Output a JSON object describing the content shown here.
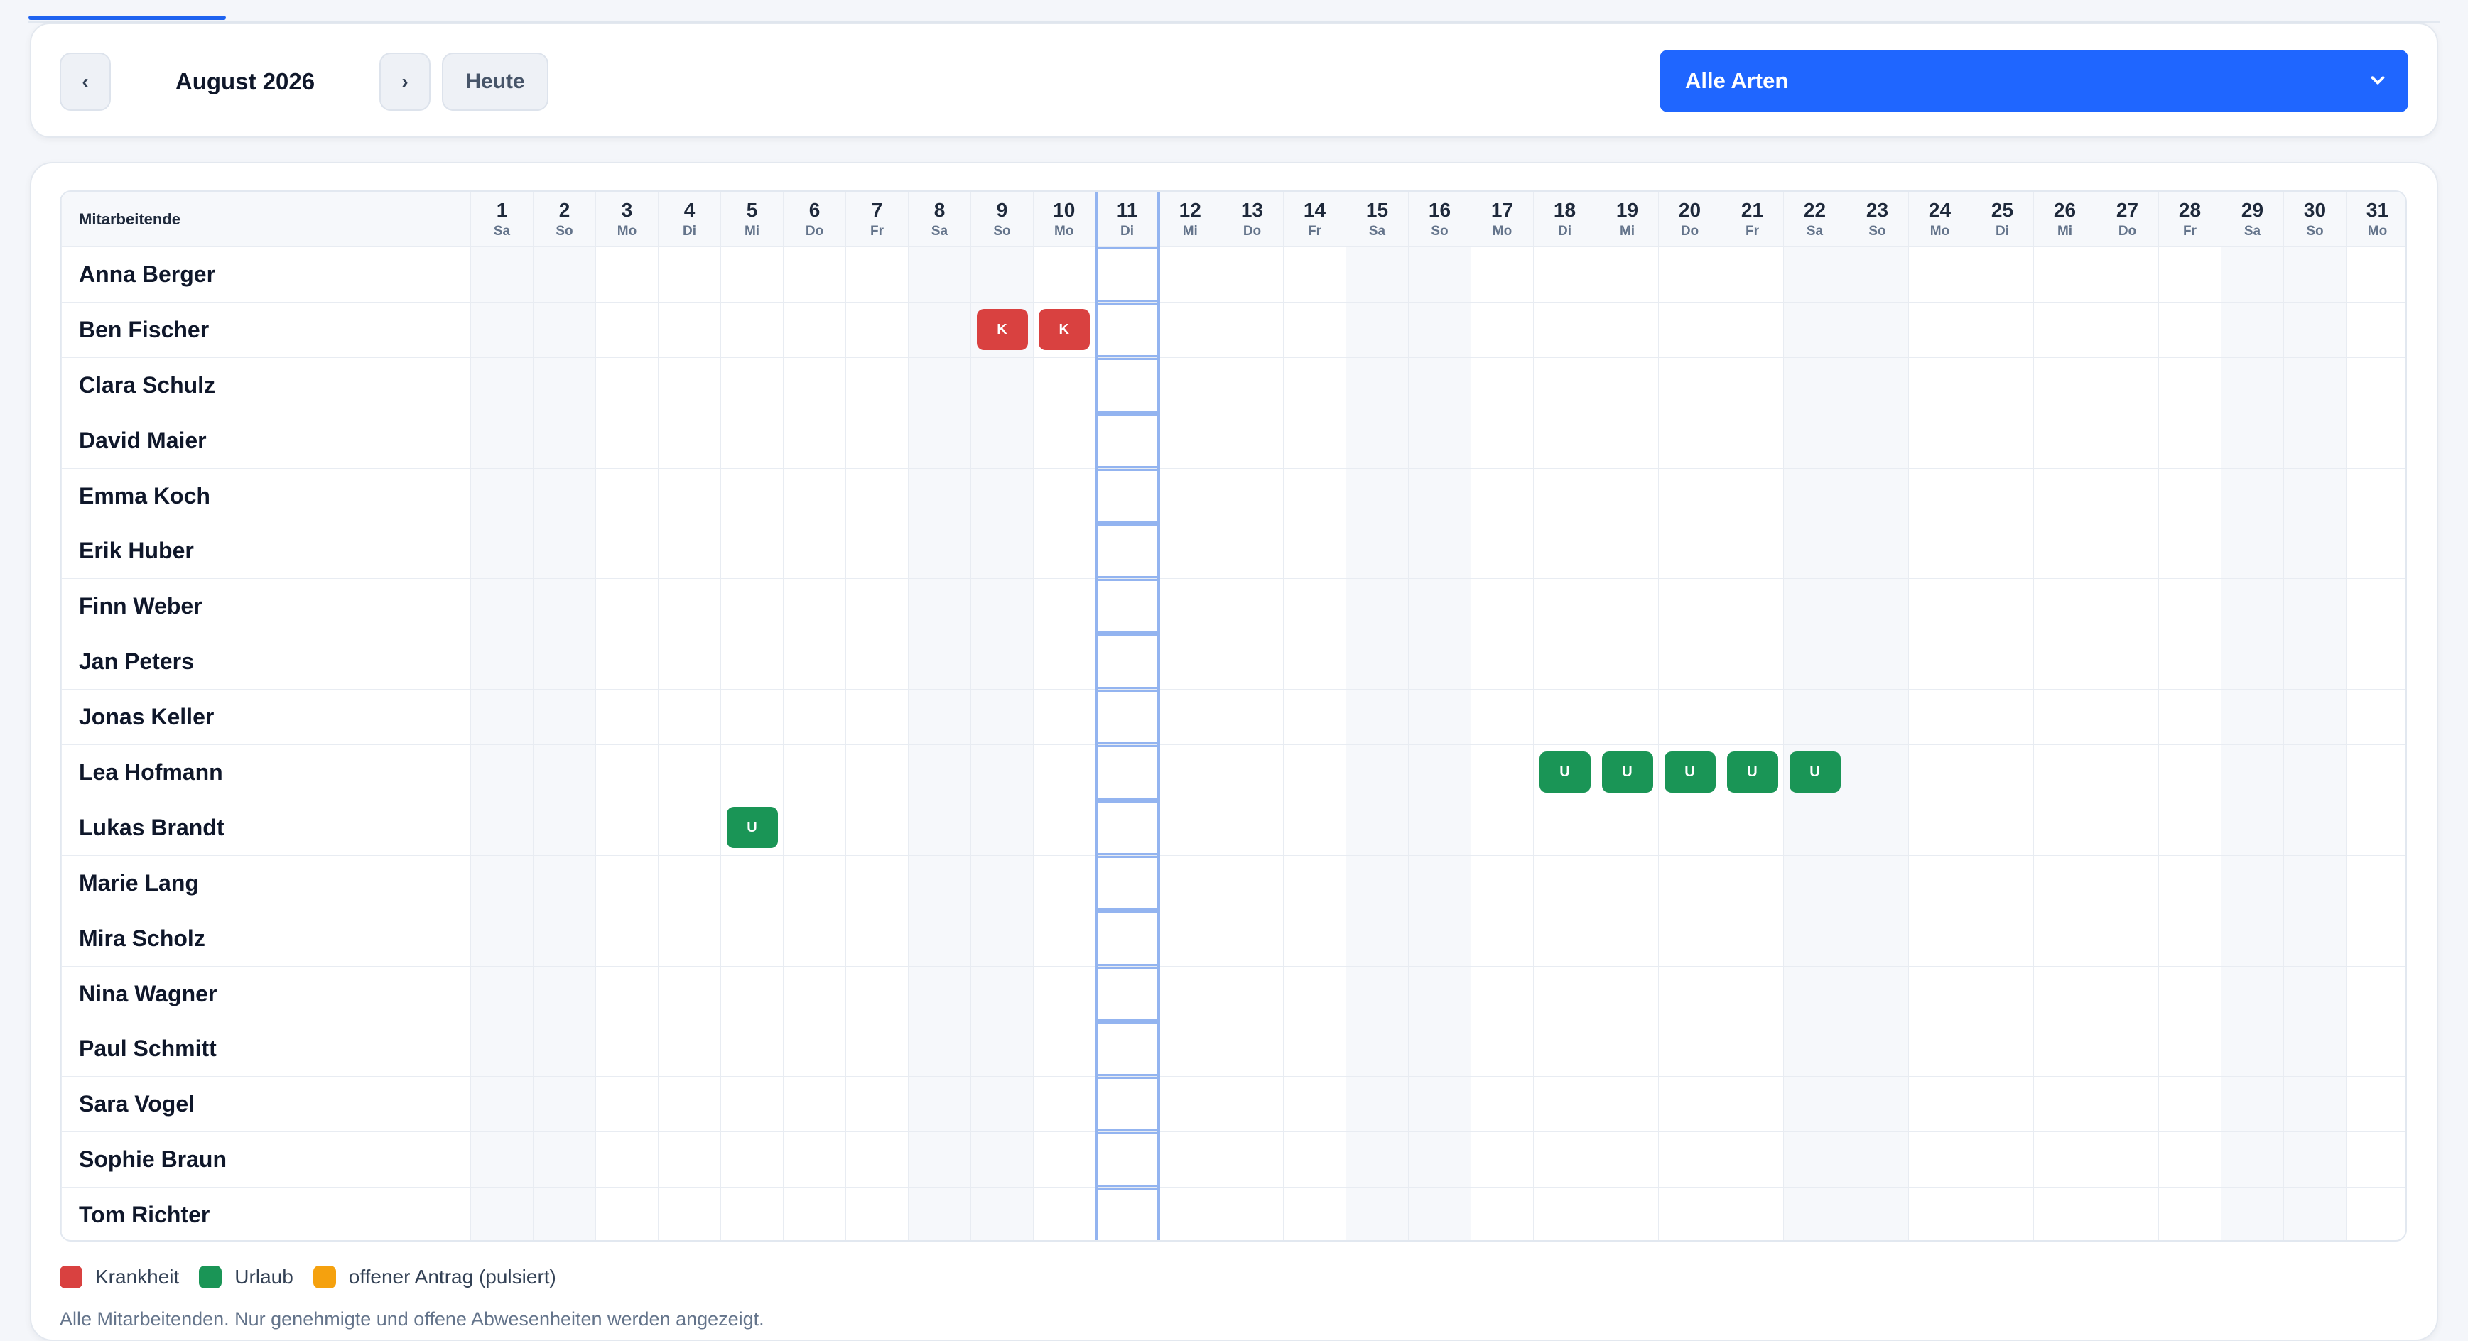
{
  "toolbar": {
    "prev_label": "‹",
    "next_label": "›",
    "month": "August 2026",
    "today_label": "Heute",
    "type_filter": "Alle Arten"
  },
  "calendar": {
    "name_header": "Mitarbeitende",
    "today_day": 11,
    "days": [
      {
        "n": "1",
        "wd": "Sa"
      },
      {
        "n": "2",
        "wd": "So"
      },
      {
        "n": "3",
        "wd": "Mo"
      },
      {
        "n": "4",
        "wd": "Di"
      },
      {
        "n": "5",
        "wd": "Mi"
      },
      {
        "n": "6",
        "wd": "Do"
      },
      {
        "n": "7",
        "wd": "Fr"
      },
      {
        "n": "8",
        "wd": "Sa"
      },
      {
        "n": "9",
        "wd": "So"
      },
      {
        "n": "10",
        "wd": "Mo"
      },
      {
        "n": "11",
        "wd": "Di"
      },
      {
        "n": "12",
        "wd": "Mi"
      },
      {
        "n": "13",
        "wd": "Do"
      },
      {
        "n": "14",
        "wd": "Fr"
      },
      {
        "n": "15",
        "wd": "Sa"
      },
      {
        "n": "16",
        "wd": "So"
      },
      {
        "n": "17",
        "wd": "Mo"
      },
      {
        "n": "18",
        "wd": "Di"
      },
      {
        "n": "19",
        "wd": "Mi"
      },
      {
        "n": "20",
        "wd": "Do"
      },
      {
        "n": "21",
        "wd": "Fr"
      },
      {
        "n": "22",
        "wd": "Sa"
      },
      {
        "n": "23",
        "wd": "So"
      },
      {
        "n": "24",
        "wd": "Mo"
      },
      {
        "n": "25",
        "wd": "Di"
      },
      {
        "n": "26",
        "wd": "Mi"
      },
      {
        "n": "27",
        "wd": "Do"
      },
      {
        "n": "28",
        "wd": "Fr"
      },
      {
        "n": "29",
        "wd": "Sa"
      },
      {
        "n": "30",
        "wd": "So"
      },
      {
        "n": "31",
        "wd": "Mo"
      }
    ],
    "employees": [
      {
        "name": "Anna Berger",
        "absences": []
      },
      {
        "name": "Ben Fischer",
        "absences": [
          {
            "day": 9,
            "code": "K"
          },
          {
            "day": 10,
            "code": "K"
          }
        ]
      },
      {
        "name": "Clara Schulz",
        "absences": []
      },
      {
        "name": "David Maier",
        "absences": []
      },
      {
        "name": "Emma Koch",
        "absences": []
      },
      {
        "name": "Erik Huber",
        "absences": []
      },
      {
        "name": "Finn Weber",
        "absences": []
      },
      {
        "name": "Jan Peters",
        "absences": []
      },
      {
        "name": "Jonas Keller",
        "absences": []
      },
      {
        "name": "Lea Hofmann",
        "absences": [
          {
            "day": 18,
            "code": "U"
          },
          {
            "day": 19,
            "code": "U"
          },
          {
            "day": 20,
            "code": "U"
          },
          {
            "day": 21,
            "code": "U"
          },
          {
            "day": 22,
            "code": "U"
          }
        ]
      },
      {
        "name": "Lukas Brandt",
        "absences": [
          {
            "day": 5,
            "code": "U"
          }
        ]
      },
      {
        "name": "Marie Lang",
        "absences": []
      },
      {
        "name": "Mira Scholz",
        "absences": []
      },
      {
        "name": "Nina Wagner",
        "absences": []
      },
      {
        "name": "Paul Schmitt",
        "absences": []
      },
      {
        "name": "Sara Vogel",
        "absences": []
      },
      {
        "name": "Sophie Braun",
        "absences": []
      },
      {
        "name": "Tom Richter",
        "absences": []
      }
    ]
  },
  "legend": [
    {
      "label": "Krankheit",
      "color": "#d94140"
    },
    {
      "label": "Urlaub",
      "color": "#1a9556"
    },
    {
      "label": "offener Antrag (pulsiert)",
      "color": "#f5a10e"
    }
  ],
  "footnote": "Alle Mitarbeitenden. Nur genehmigte und offene Abwesenheiten werden angezeigt.",
  "colors": {
    "accent": "#1f66ff",
    "sick": "#d94140",
    "vacation": "#1a9556",
    "pending": "#f5a10e",
    "today_outline": "#93b4f0"
  }
}
